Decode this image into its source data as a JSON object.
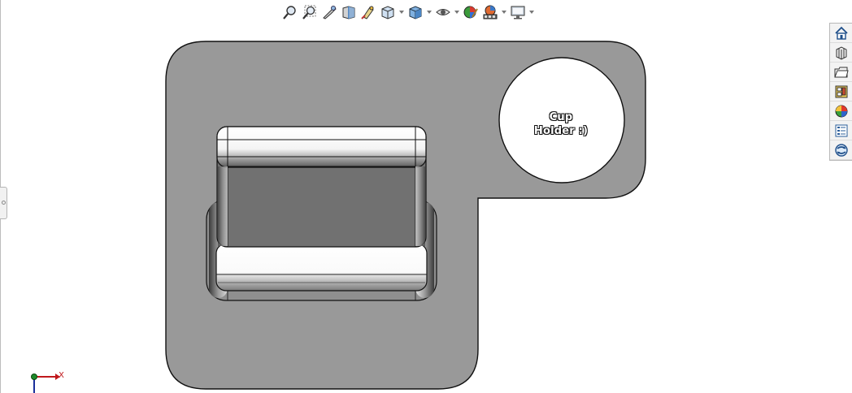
{
  "viewport": {
    "model_label_line1": "Cup",
    "model_label_line2": "Holder :)",
    "body_color": "#999999",
    "box_top_color": "#717171",
    "axis_x_label": "X"
  },
  "heads_up_toolbar": {
    "buttons": [
      "zoom-to-fit-icon",
      "zoom-to-area-icon",
      "previous-view-icon",
      "section-view-icon",
      "dynamic-annotation-icon",
      "view-orientation-icon",
      "display-style-icon",
      "hide-show-items-icon",
      "edit-appearance-icon",
      "apply-scene-icon",
      "view-settings-icon"
    ]
  },
  "task_pane": {
    "items": [
      "solidworks-resources-icon",
      "design-library-icon",
      "file-explorer-icon",
      "view-palette-icon",
      "appearances-scenes-icon",
      "custom-properties-icon",
      "solidworks-forum-icon"
    ]
  }
}
